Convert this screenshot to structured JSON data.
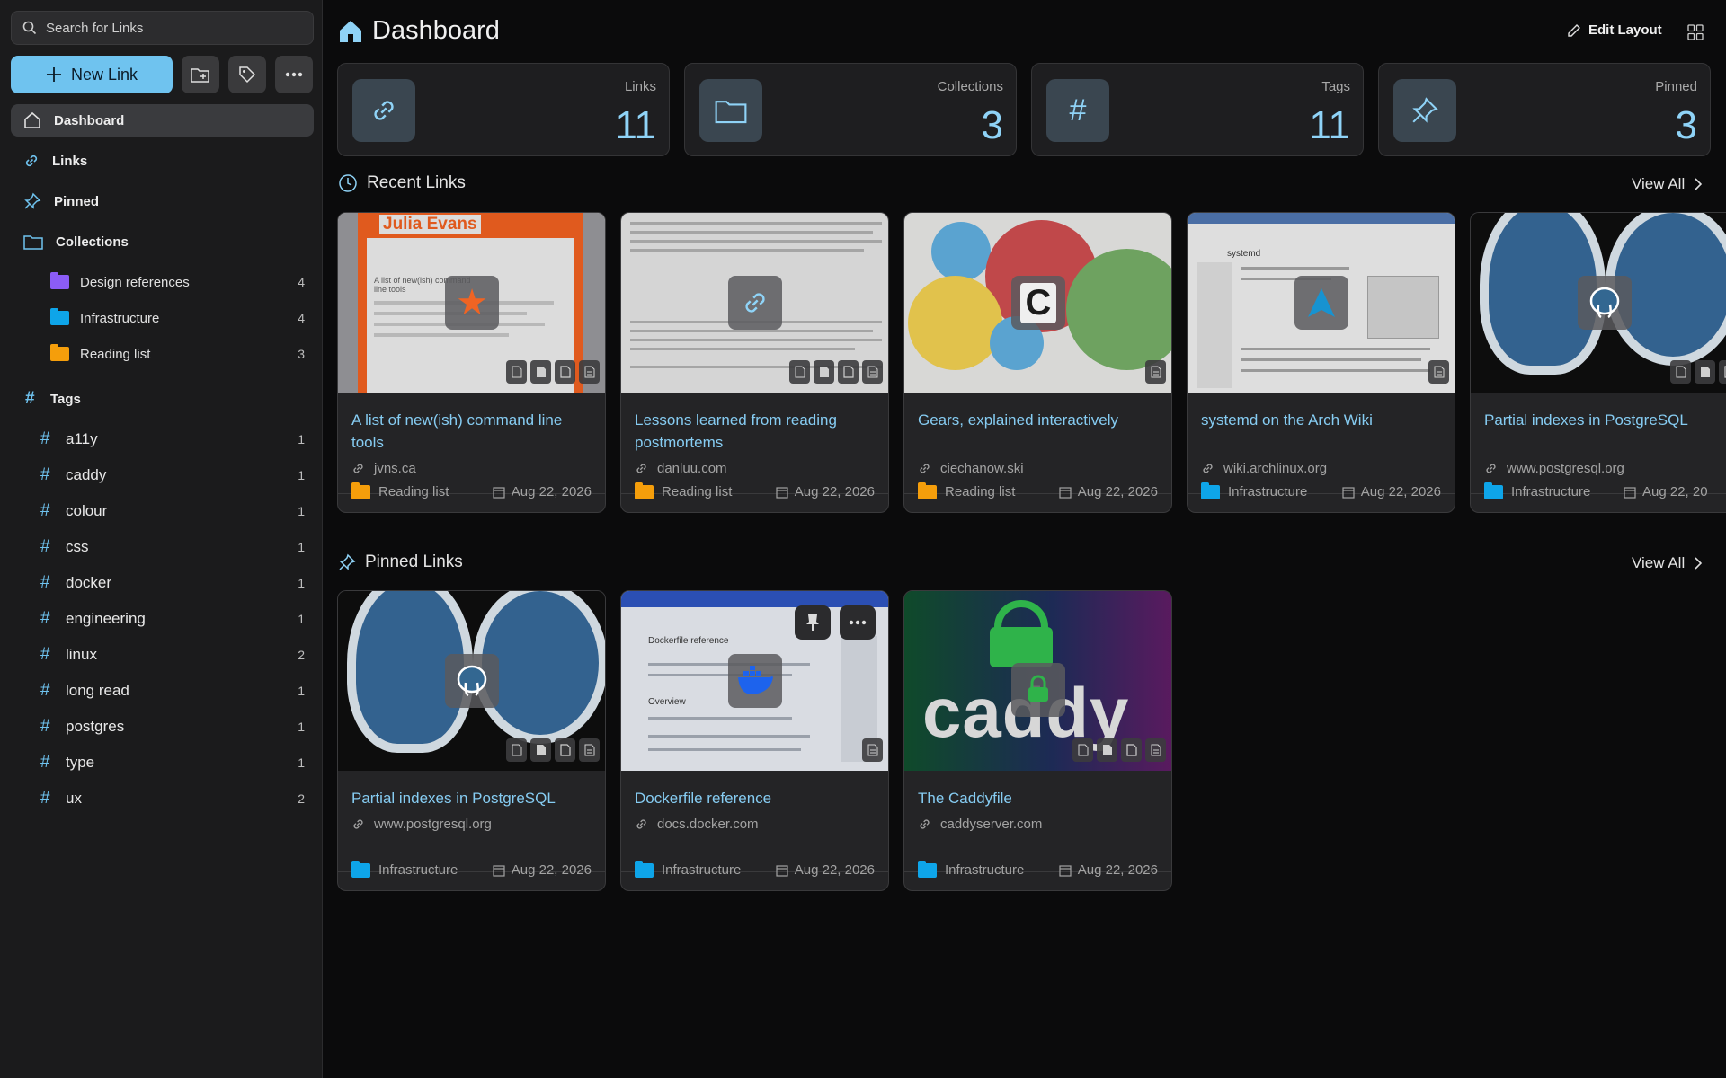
{
  "search": {
    "placeholder": "Search for Links"
  },
  "sidebar": {
    "new_link_label": "New Link",
    "nav": [
      {
        "label": "Dashboard"
      },
      {
        "label": "Links"
      },
      {
        "label": "Pinned"
      },
      {
        "label": "Collections"
      }
    ],
    "collections": [
      {
        "name": "Design references",
        "count": "4",
        "color": "#8b5cf6"
      },
      {
        "name": "Infrastructure",
        "count": "4",
        "color": "#0ea5e9"
      },
      {
        "name": "Reading list",
        "count": "3",
        "color": "#f59e0b"
      }
    ],
    "tags_label": "Tags",
    "tags": [
      {
        "name": "a11y",
        "count": "1"
      },
      {
        "name": "caddy",
        "count": "1"
      },
      {
        "name": "colour",
        "count": "1"
      },
      {
        "name": "css",
        "count": "1"
      },
      {
        "name": "docker",
        "count": "1"
      },
      {
        "name": "engineering",
        "count": "1"
      },
      {
        "name": "linux",
        "count": "2"
      },
      {
        "name": "long read",
        "count": "1"
      },
      {
        "name": "postgres",
        "count": "1"
      },
      {
        "name": "type",
        "count": "1"
      },
      {
        "name": "ux",
        "count": "2"
      }
    ]
  },
  "header": {
    "title": "Dashboard",
    "edit_layout": "Edit Layout"
  },
  "stats": [
    {
      "label": "Links",
      "value": "11",
      "icon": "link-icon"
    },
    {
      "label": "Collections",
      "value": "3",
      "icon": "folder-icon"
    },
    {
      "label": "Tags",
      "value": "11",
      "icon": "hash-icon"
    },
    {
      "label": "Pinned",
      "value": "3",
      "icon": "pin-icon"
    }
  ],
  "recent": {
    "heading": "Recent Links",
    "view_all": "View All",
    "cards": [
      {
        "title": "A list of new(ish) command line tools",
        "domain": "jvns.ca",
        "collection": "Reading list",
        "date": "Aug 22, 2026",
        "collection_color": "#f59e0b"
      },
      {
        "title": "Lessons learned from reading postmortems",
        "domain": "danluu.com",
        "collection": "Reading list",
        "date": "Aug 22, 2026",
        "collection_color": "#f59e0b"
      },
      {
        "title": "Gears, explained interactively",
        "domain": "ciechanow.ski",
        "collection": "Reading list",
        "date": "Aug 22, 2026",
        "collection_color": "#f59e0b"
      },
      {
        "title": "systemd on the Arch Wiki",
        "domain": "wiki.archlinux.org",
        "collection": "Infrastructure",
        "date": "Aug 22, 2026",
        "collection_color": "#0ea5e9"
      },
      {
        "title": "Partial indexes in PostgreSQL",
        "domain": "www.postgresql.org",
        "collection": "Infrastructure",
        "date": "Aug 22, 20",
        "collection_color": "#0ea5e9"
      }
    ]
  },
  "pinned": {
    "heading": "Pinned Links",
    "view_all": "View All",
    "cards": [
      {
        "title": "Partial indexes in PostgreSQL",
        "domain": "www.postgresql.org",
        "collection": "Infrastructure",
        "date": "Aug 22, 2026",
        "collection_color": "#0ea5e9"
      },
      {
        "title": "Dockerfile reference",
        "domain": "docs.docker.com",
        "collection": "Infrastructure",
        "date": "Aug 22, 2026",
        "collection_color": "#0ea5e9"
      },
      {
        "title": "The Caddyfile",
        "domain": "caddyserver.com",
        "collection": "Infrastructure",
        "date": "Aug 22, 2026",
        "collection_color": "#0ea5e9"
      }
    ]
  },
  "thumb_texts": {
    "julia": "Julia Evans",
    "julia_sub": "A list of new(ish) command line tools",
    "arch_title": "systemd",
    "docker_title": "Dockerfile reference",
    "docker_sub": "Overview",
    "caddy_word": "caddy"
  },
  "colors": {
    "accent": "#6fc3ef",
    "stat_number": "#8fd3f7",
    "link_title": "#86ccf2"
  }
}
